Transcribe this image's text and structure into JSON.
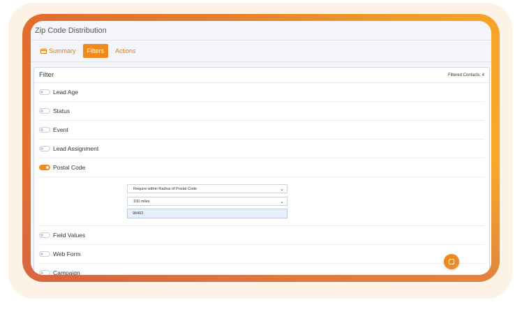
{
  "window": {
    "title": "Zip Code Distribution"
  },
  "tabs": [
    {
      "label": "Summary",
      "icon": "table-icon"
    },
    {
      "label": "Filters"
    },
    {
      "label": "Actions"
    }
  ],
  "filter": {
    "title": "Filter",
    "count_text": "Filtered Contacts: 4",
    "rows": [
      {
        "label": "Lead Age",
        "on": false
      },
      {
        "label": "Status",
        "on": false
      },
      {
        "label": "Event",
        "on": false
      },
      {
        "label": "Lead Assignment",
        "on": false
      },
      {
        "label": "Postal Code",
        "on": true
      },
      {
        "label": "Field Values",
        "on": false
      },
      {
        "label": "Web Form",
        "on": false
      },
      {
        "label": "Campaign",
        "on": false
      }
    ],
    "postal": {
      "mode_value": "Require within Radius of Postal Code",
      "radius_value": "100 miles",
      "zip_value": "98402"
    }
  },
  "colors": {
    "accent": "#ef8a1f",
    "frame_start": "#e26b2d",
    "frame_end": "#f7ae27"
  },
  "chat": {
    "icon": "chat-icon"
  }
}
